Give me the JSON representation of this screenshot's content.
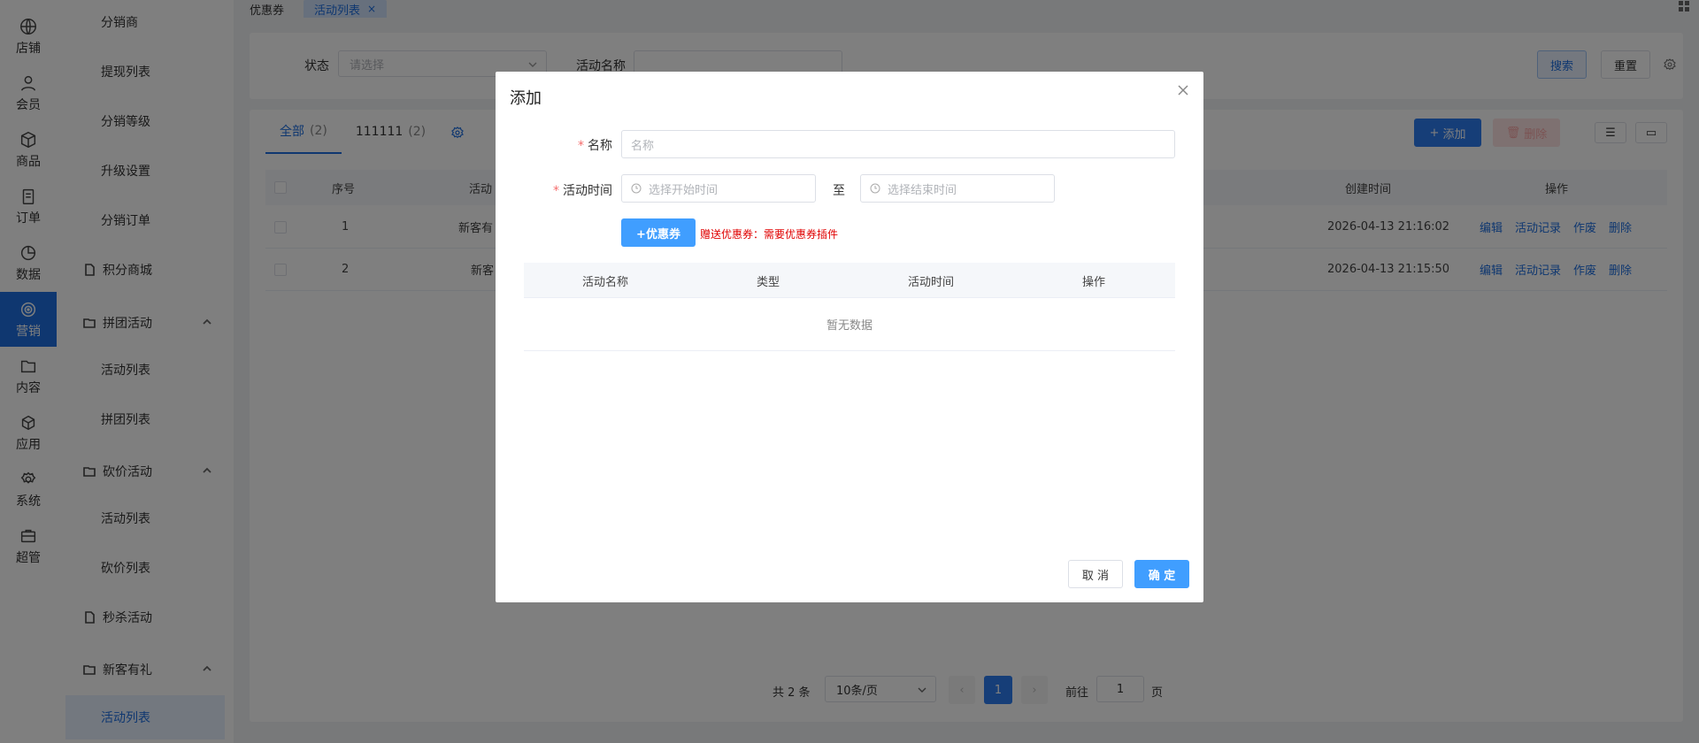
{
  "rail": [
    {
      "label": "店铺",
      "icon": "globe-icon"
    },
    {
      "label": "会员",
      "icon": "user-icon"
    },
    {
      "label": "商品",
      "icon": "box-icon"
    },
    {
      "label": "订单",
      "icon": "clipboard-icon"
    },
    {
      "label": "数据",
      "icon": "pie-chart-icon"
    },
    {
      "label": "营销",
      "icon": "target-icon",
      "active": true
    },
    {
      "label": "内容",
      "icon": "folder-icon"
    },
    {
      "label": "应用",
      "icon": "cube-icon"
    },
    {
      "label": "系统",
      "icon": "gear-icon"
    },
    {
      "label": "超管",
      "icon": "briefcase-icon"
    }
  ],
  "submenu": [
    {
      "label": "分销商",
      "type": "leaf"
    },
    {
      "label": "提现列表",
      "type": "leaf"
    },
    {
      "label": "分销等级",
      "type": "leaf"
    },
    {
      "label": "升级设置",
      "type": "leaf"
    },
    {
      "label": "分销订单",
      "type": "leaf"
    },
    {
      "label": "积分商城",
      "type": "page"
    },
    {
      "label": "拼团活动",
      "type": "group"
    },
    {
      "label": "活动列表",
      "type": "leaf"
    },
    {
      "label": "拼团列表",
      "type": "leaf"
    },
    {
      "label": "砍价活动",
      "type": "group"
    },
    {
      "label": "活动列表",
      "type": "leaf"
    },
    {
      "label": "砍价列表",
      "type": "leaf"
    },
    {
      "label": "秒杀活动",
      "type": "page"
    },
    {
      "label": "新客有礼",
      "type": "group"
    },
    {
      "label": "活动列表",
      "type": "leaf",
      "active": true
    }
  ],
  "tabs": {
    "first": "优惠券",
    "active": "活动列表",
    "close": "×"
  },
  "filter": {
    "status_label": "状态",
    "status_placeholder": "请选择",
    "name_label": "活动名称",
    "name_value": "",
    "search": "搜索",
    "reset": "重置"
  },
  "list": {
    "tab_all": "全部",
    "tab_all_count": "(2)",
    "tab_other": "111111",
    "tab_other_count": "(2)",
    "add": "添加",
    "delete": "删除",
    "columns": {
      "no": "序号",
      "name": "活动",
      "created": "创建时间",
      "ops": "操作"
    },
    "rows": [
      {
        "no": "1",
        "name": "新客有",
        "created": "2026-04-13 21:16:02"
      },
      {
        "no": "2",
        "name": "新客",
        "created": "2026-04-13 21:15:50"
      }
    ],
    "row_ops": [
      "编辑",
      "活动记录",
      "作废",
      "删除"
    ]
  },
  "pager": {
    "total": "共 2 条",
    "page_size": "10条/页",
    "current": "1",
    "goto_label": "前往",
    "goto_value": "1",
    "page_unit": "页"
  },
  "dialog": {
    "title": "添加",
    "name_label": "名称",
    "name_placeholder": "名称",
    "time_label": "活动时间",
    "start_placeholder": "选择开始时间",
    "to": "至",
    "end_placeholder": "选择结束时间",
    "coupon_button": "+优惠券",
    "coupon_tip": "赠送优惠券：需要优惠券插件",
    "table_columns": [
      "活动名称",
      "类型",
      "活动时间",
      "操作"
    ],
    "empty": "暂无数据",
    "cancel": "取 消",
    "confirm": "确 定"
  },
  "colors": {
    "primary": "#1e6fe0",
    "button_blue": "#409eff",
    "danger_text": "#e00000",
    "required": "#f56c6c"
  }
}
